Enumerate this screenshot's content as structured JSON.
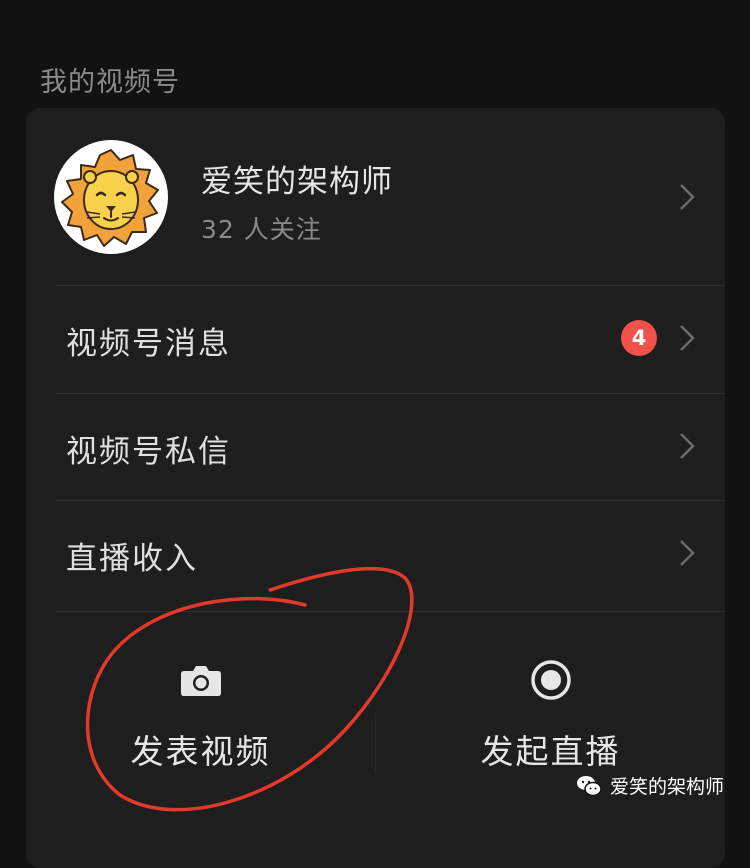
{
  "section": {
    "title": "我的视频号"
  },
  "profile": {
    "name": "爱笑的架构师",
    "followers": "32 人关注",
    "avatar_icon": "lion-avatar-icon"
  },
  "menu": [
    {
      "label": "视频号消息",
      "badge": "4"
    },
    {
      "label": "视频号私信"
    },
    {
      "label": "直播收入"
    }
  ],
  "actions": [
    {
      "label": "发表视频",
      "icon": "camera-icon"
    },
    {
      "label": "发起直播",
      "icon": "live-record-icon"
    }
  ],
  "watermark": {
    "text": "爱笑的架构师",
    "icon": "wechat-icon"
  },
  "colors": {
    "background": "#121212",
    "card": "#1e1e1e",
    "badge": "#f15148",
    "annotation": "#e23a2a"
  }
}
